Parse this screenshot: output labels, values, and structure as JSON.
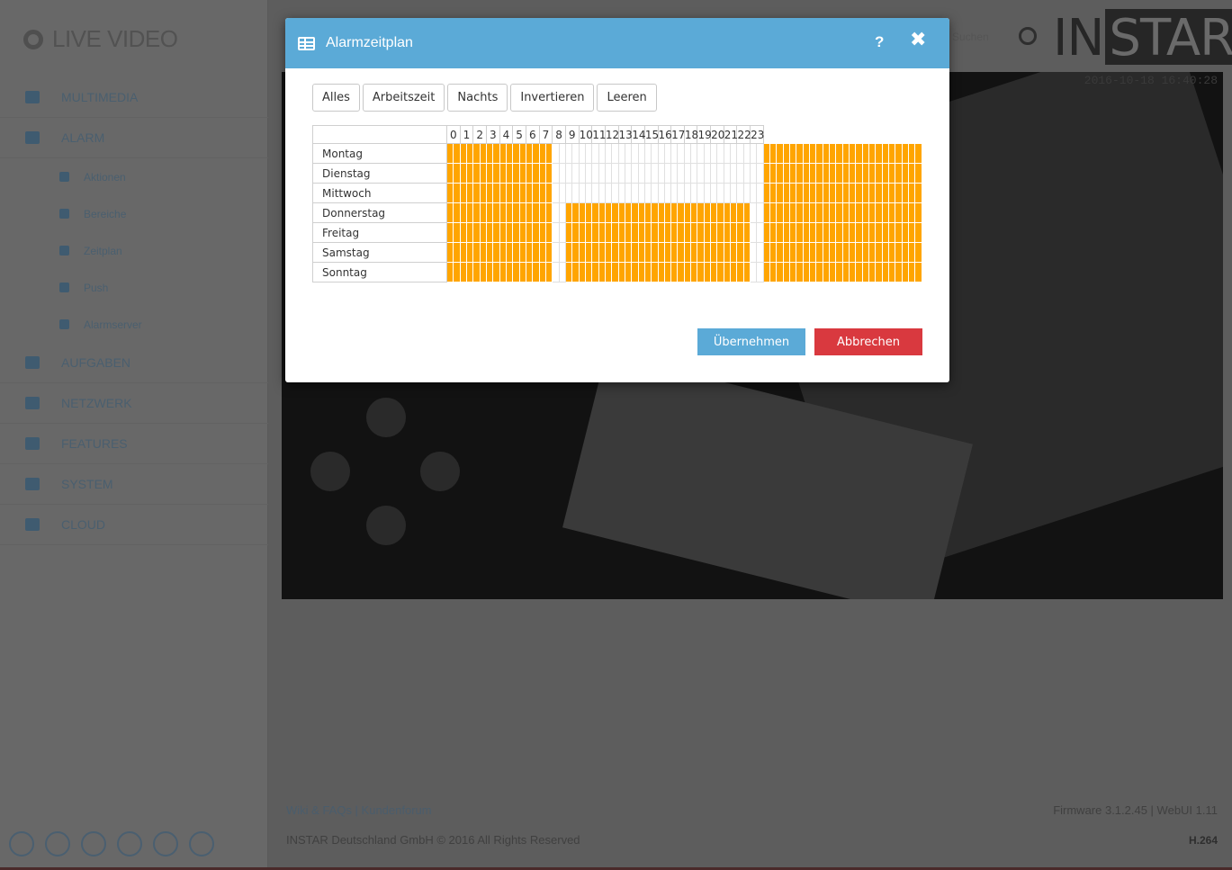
{
  "app": {
    "logo_text": "LIVE VIDEO",
    "brand_left": "IN",
    "brand_right": "STAR",
    "top_link": "Suchen",
    "timestamp": "2016-10-18 16:40:28"
  },
  "sidebar": {
    "items": [
      {
        "label": "MULTIMEDIA",
        "icon": "image-icon",
        "level": 0
      },
      {
        "label": "ALARM",
        "icon": "bell-icon",
        "level": 0
      },
      {
        "label": "Aktionen",
        "icon": "bell-icon",
        "level": 1
      },
      {
        "label": "Bereiche",
        "icon": "grid-icon",
        "level": 1
      },
      {
        "label": "Zeitplan",
        "icon": "table-icon",
        "level": 1
      },
      {
        "label": "Push",
        "icon": "phone-icon",
        "level": 1
      },
      {
        "label": "Alarmserver",
        "icon": "server-icon",
        "level": 1
      },
      {
        "label": "AUFGABEN",
        "icon": "tasks-icon",
        "level": 0
      },
      {
        "label": "NETZWERK",
        "icon": "network-icon",
        "level": 0
      },
      {
        "label": "FEATURES",
        "icon": "star-icon",
        "level": 0
      },
      {
        "label": "SYSTEM",
        "icon": "gear-icon",
        "level": 0
      },
      {
        "label": "CLOUD",
        "icon": "cloud-icon",
        "level": 0
      }
    ],
    "social": [
      "instar-icon",
      "youtube-icon",
      "wiki-icon",
      "twitter-icon",
      "google-plus-icon",
      "facebook-icon"
    ]
  },
  "footer": {
    "links": "Wiki & FAQs | Kundenforum",
    "copyright": "INSTAR Deutschland GmbH © 2016 All Rights Reserved",
    "firmware": "Firmware 3.1.2.45 | WebUI 1.11",
    "codec": "H.264"
  },
  "modal": {
    "title": "Alarmzeitplan",
    "help_label": "?",
    "close_label": "✖",
    "presets": [
      "Alles",
      "Arbeitszeit",
      "Nachts",
      "Invertieren",
      "Leeren"
    ],
    "apply_label": "Übernehmen",
    "cancel_label": "Abbrechen",
    "colors": {
      "header": "#5baad7",
      "active_slot": "#ffa500",
      "cancel": "#d9393f"
    }
  },
  "schedule": {
    "hours": [
      "0",
      "1",
      "2",
      "3",
      "4",
      "5",
      "6",
      "7",
      "8",
      "9",
      "10",
      "11",
      "12",
      "13",
      "14",
      "15",
      "16",
      "17",
      "18",
      "19",
      "20",
      "21",
      "22",
      "23"
    ],
    "slots_per_hour": 2,
    "days": [
      {
        "name": "Montag",
        "slots": "111111111111111100000000000000000000000000000000111111111111111111111111"
      },
      {
        "name": "Dienstag",
        "slots": "111111111111111100000000000000000000000000000000111111111111111111111111"
      },
      {
        "name": "Mittwoch",
        "slots": "111111111111111100000000000000000000000000000000111111111111111111111111"
      },
      {
        "name": "Donnerstag",
        "slots": "111111111111111100111111111111111111111111111100111111111111111111111111"
      },
      {
        "name": "Freitag",
        "slots": "111111111111111100111111111111111111111111111100111111111111111111111111"
      },
      {
        "name": "Samstag",
        "slots": "111111111111111100111111111111111111111111111100111111111111111111111111"
      },
      {
        "name": "Sonntag",
        "slots": "111111111111111100111111111111111111111111111100111111111111111111111111"
      }
    ]
  }
}
